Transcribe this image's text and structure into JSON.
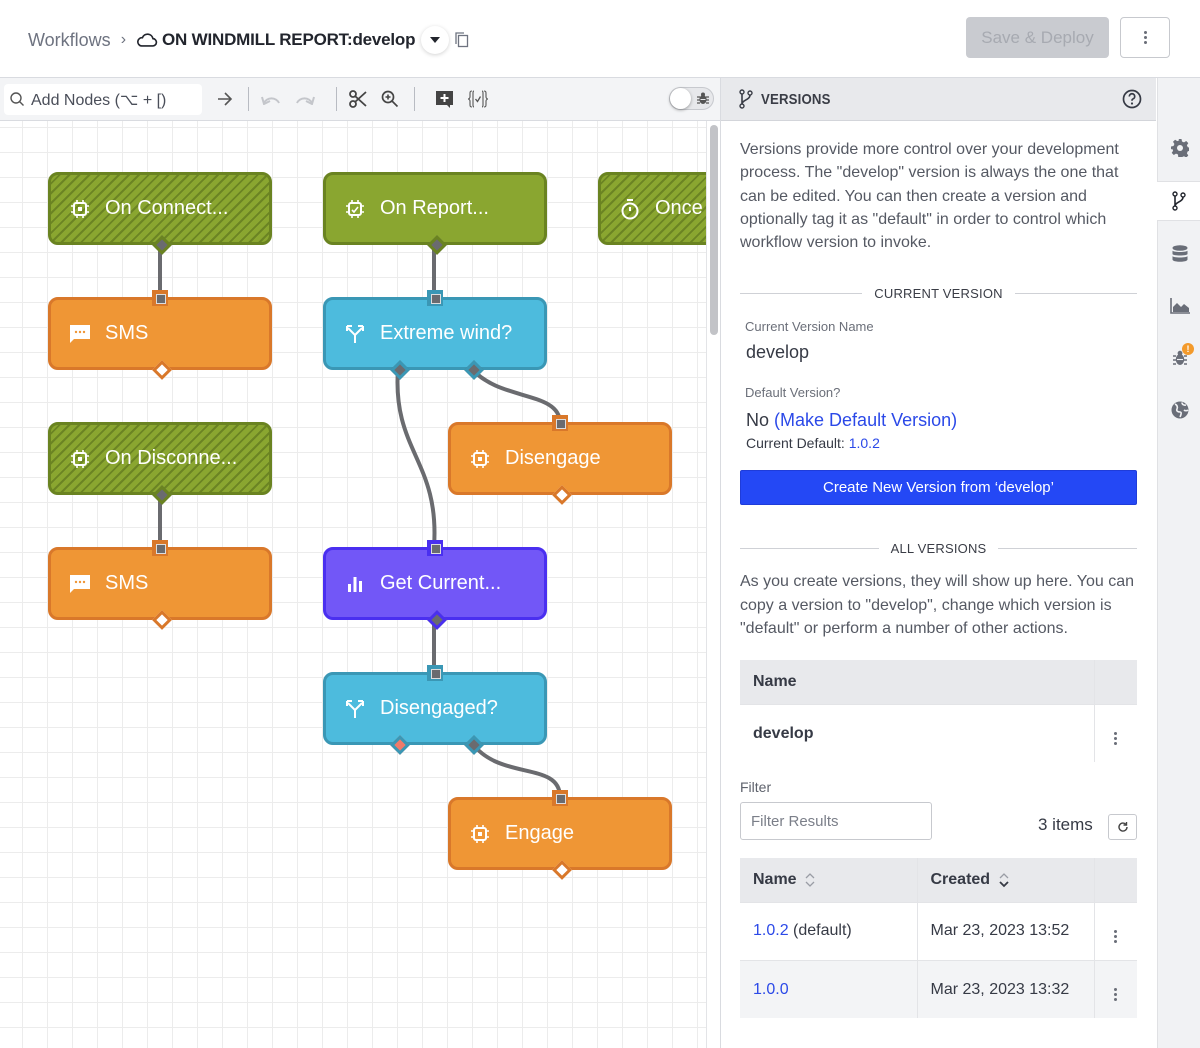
{
  "header": {
    "breadcrumb_root": "Workflows",
    "breadcrumb_separator": "›",
    "workflow_title": "ON WINDMILL REPORT:develop",
    "save_deploy_label": "Save & Deploy"
  },
  "toolbar": {
    "add_nodes_placeholder": "Add Nodes (⌥ + [)",
    "icons": [
      "search-icon",
      "arrow-right-icon",
      "undo-icon",
      "redo-icon",
      "scissors-icon",
      "zoom-icon",
      "add-comment-icon",
      "variables-icon",
      "debug-toggle"
    ]
  },
  "canvas": {
    "nodes": [
      {
        "id": "on-connect",
        "label": "On Connect...",
        "type": "device-trigger",
        "style": "trigger-disabled",
        "icon": "device-icon"
      },
      {
        "id": "sms-1",
        "label": "SMS",
        "type": "sms",
        "style": "action",
        "icon": "sms-icon"
      },
      {
        "id": "on-disconnect",
        "label": "On Disconne...",
        "type": "device-trigger",
        "style": "trigger-disabled",
        "icon": "device-icon"
      },
      {
        "id": "sms-2",
        "label": "SMS",
        "type": "sms",
        "style": "action",
        "icon": "sms-icon"
      },
      {
        "id": "on-report",
        "label": "On Report...",
        "type": "device-trigger",
        "style": "trigger",
        "icon": "device-report-icon"
      },
      {
        "id": "extreme-wind",
        "label": "Extreme wind?",
        "type": "conditional",
        "style": "conditional",
        "icon": "branch-icon"
      },
      {
        "id": "disengage",
        "label": "Disengage",
        "type": "device-command",
        "style": "action",
        "icon": "device-icon"
      },
      {
        "id": "get-current",
        "label": "Get Current...",
        "type": "data",
        "style": "data",
        "icon": "chart-icon"
      },
      {
        "id": "disengaged",
        "label": "Disengaged?",
        "type": "conditional",
        "style": "conditional",
        "icon": "branch-icon"
      },
      {
        "id": "engage",
        "label": "Engage",
        "type": "device-command",
        "style": "action",
        "icon": "device-icon"
      },
      {
        "id": "once",
        "label": "Once ...",
        "type": "timer-trigger",
        "style": "trigger-disabled",
        "icon": "timer-icon"
      }
    ],
    "edges": [
      {
        "from": "on-connect",
        "to": "sms-1"
      },
      {
        "from": "on-disconnect",
        "to": "sms-2"
      },
      {
        "from": "on-report",
        "to": "extreme-wind"
      },
      {
        "from": "extreme-wind",
        "branch": "true",
        "to": "get-current"
      },
      {
        "from": "extreme-wind",
        "branch": "false",
        "to": "disengage"
      },
      {
        "from": "get-current",
        "to": "disengaged"
      },
      {
        "from": "disengaged",
        "branch": "false",
        "to": "engage"
      }
    ]
  },
  "panel": {
    "title": "VERSIONS",
    "intro": "Versions provide more control over your development process. The \"develop\" version is always the one that can be edited. You can then create a version and optionally tag it as \"default\" in order to control which workflow version to invoke.",
    "current_section": "CURRENT VERSION",
    "current_name_label": "Current Version Name",
    "current_name": "develop",
    "default_label": "Default Version?",
    "default_value": "No",
    "make_default_link": "(Make Default Version)",
    "current_default_label": "Current Default:",
    "current_default_value": "1.0.2",
    "create_button": "Create New Version from ‘develop’",
    "all_section": "ALL VERSIONS",
    "all_intro": "As you create versions, they will show up here. You can copy a version to \"develop\", change which version is \"default\" or perform a number of other actions.",
    "develop_table": {
      "header": "Name",
      "row": "develop"
    },
    "filter_label": "Filter",
    "filter_placeholder": "Filter Results",
    "filter_value": "",
    "items_count": "3 items",
    "versions_table": {
      "columns": [
        "Name",
        "Created"
      ],
      "rows": [
        {
          "name": "1.0.2",
          "suffix": "(default)",
          "created": "Mar 23, 2023 13:52"
        },
        {
          "name": "1.0.0",
          "suffix": "",
          "created": "Mar 23, 2023 13:32"
        }
      ]
    }
  },
  "rail": {
    "items": [
      {
        "name": "settings",
        "icon": "gear-icon",
        "active": false
      },
      {
        "name": "versions",
        "icon": "branch-icon",
        "active": true
      },
      {
        "name": "storage",
        "icon": "database-icon",
        "active": false
      },
      {
        "name": "stats",
        "icon": "area-chart-icon",
        "active": false
      },
      {
        "name": "debug",
        "icon": "bug-icon",
        "active": false,
        "badge": "!"
      },
      {
        "name": "globals",
        "icon": "globe-icon",
        "active": false
      }
    ]
  },
  "colors": {
    "trigger": "#8aa630",
    "action": "#ef9635",
    "conditional": "#4dbbdd",
    "data": "#7257f7",
    "primary_button": "#2448f5",
    "link": "#2b49e8",
    "badge": "#f39a2b"
  }
}
